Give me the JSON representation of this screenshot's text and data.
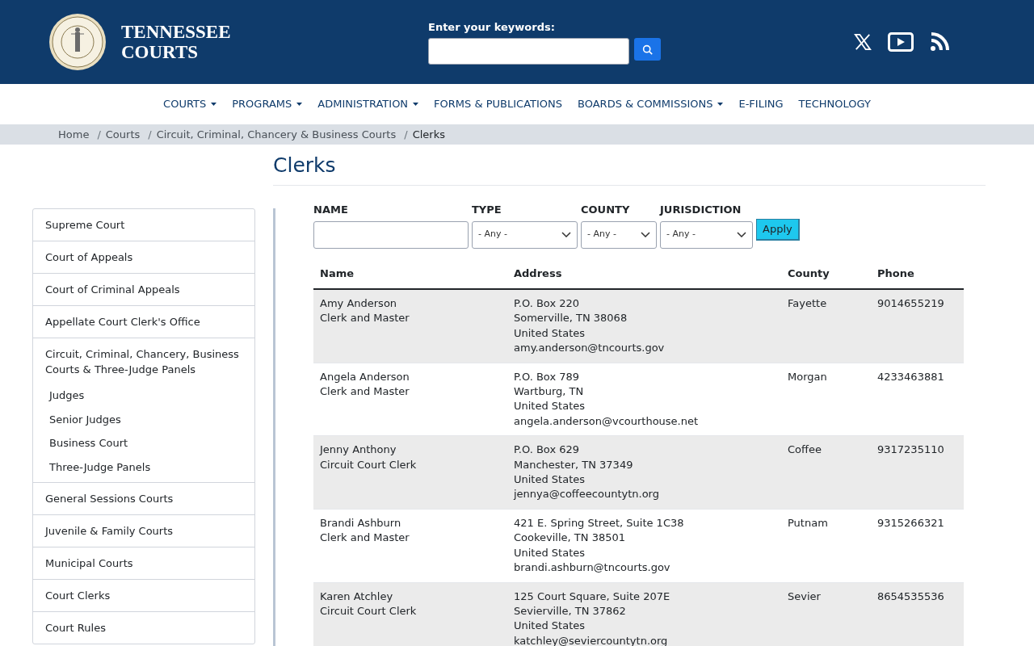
{
  "header": {
    "site_title": [
      "TENNESSEE",
      "COURTS"
    ],
    "search": {
      "label": "Enter your keywords:"
    }
  },
  "nav": [
    {
      "label": "COURTS",
      "dropdown": true
    },
    {
      "label": "PROGRAMS",
      "dropdown": true
    },
    {
      "label": "ADMINISTRATION",
      "dropdown": true
    },
    {
      "label": "FORMS & PUBLICATIONS",
      "dropdown": false
    },
    {
      "label": "BOARDS & COMMISSIONS",
      "dropdown": true
    },
    {
      "label": "E-FILING",
      "dropdown": false
    },
    {
      "label": "TECHNOLOGY",
      "dropdown": false
    }
  ],
  "breadcrumb_separator": "/",
  "breadcrumb": [
    {
      "label": "Home",
      "current": false
    },
    {
      "label": "Courts",
      "current": false
    },
    {
      "label": "Circuit, Criminal, Chancery & Business Courts",
      "current": false
    },
    {
      "label": "Clerks",
      "current": true
    }
  ],
  "page_title": "Clerks",
  "sidebar": {
    "items": [
      {
        "label": "Supreme Court"
      },
      {
        "label": "Court of Appeals"
      },
      {
        "label": "Court of Criminal Appeals"
      },
      {
        "label": "Appellate Court Clerk's Office"
      },
      {
        "label": "Circuit, Criminal, Chancery, Business Courts & Three-Judge Panels",
        "children": [
          {
            "label": "Judges"
          },
          {
            "label": "Senior Judges"
          },
          {
            "label": "Business Court"
          },
          {
            "label": "Three-Judge Panels"
          }
        ]
      },
      {
        "label": "General Sessions Courts"
      },
      {
        "label": "Juvenile & Family Courts"
      },
      {
        "label": "Municipal Courts"
      },
      {
        "label": "Court Clerks"
      },
      {
        "label": "Court Rules"
      }
    ]
  },
  "filters": [
    {
      "kind": "text",
      "label": "NAME"
    },
    {
      "kind": "select",
      "label": "TYPE",
      "value": "- Any -"
    },
    {
      "kind": "select",
      "label": "COUNTY",
      "value": "- Any -"
    },
    {
      "kind": "select",
      "label": "JURISDICTION",
      "value": "- Any -"
    }
  ],
  "apply_button": "Apply",
  "table": {
    "columns": [
      "Name",
      "Address",
      "County",
      "Phone"
    ],
    "rows": [
      {
        "name": "Amy Anderson",
        "title": "Clerk and Master",
        "address": [
          "P.O. Box 220",
          "Somerville, TN 38068",
          "United States",
          "amy.anderson@tncourts.gov"
        ],
        "county": "Fayette",
        "phone": "9014655219"
      },
      {
        "name": "Angela Anderson",
        "title": "Clerk and Master",
        "address": [
          "P.O. Box 789",
          "Wartburg, TN",
          "United States",
          "angela.anderson@vcourthouse.net"
        ],
        "county": "Morgan",
        "phone": "4233463881"
      },
      {
        "name": "Jenny Anthony",
        "title": "Circuit Court Clerk",
        "address": [
          "P.O. Box 629",
          "Manchester, TN 37349",
          "United States",
          "jennya@coffeecountytn.org"
        ],
        "county": "Coffee",
        "phone": "9317235110"
      },
      {
        "name": "Brandi Ashburn",
        "title": "Clerk and Master",
        "address": [
          "421 E. Spring Street, Suite 1C38",
          "Cookeville, TN 38501",
          "United States",
          "brandi.ashburn@tncourts.gov"
        ],
        "county": "Putnam",
        "phone": "9315266321"
      },
      {
        "name": "Karen Atchley",
        "title": "Circuit Court Clerk",
        "address": [
          "125 Court Square, Suite 207E",
          "Sevierville, TN 37862",
          "United States",
          "katchley@seviercountytn.org"
        ],
        "county": "Sevier",
        "phone": "8654535536"
      }
    ]
  }
}
